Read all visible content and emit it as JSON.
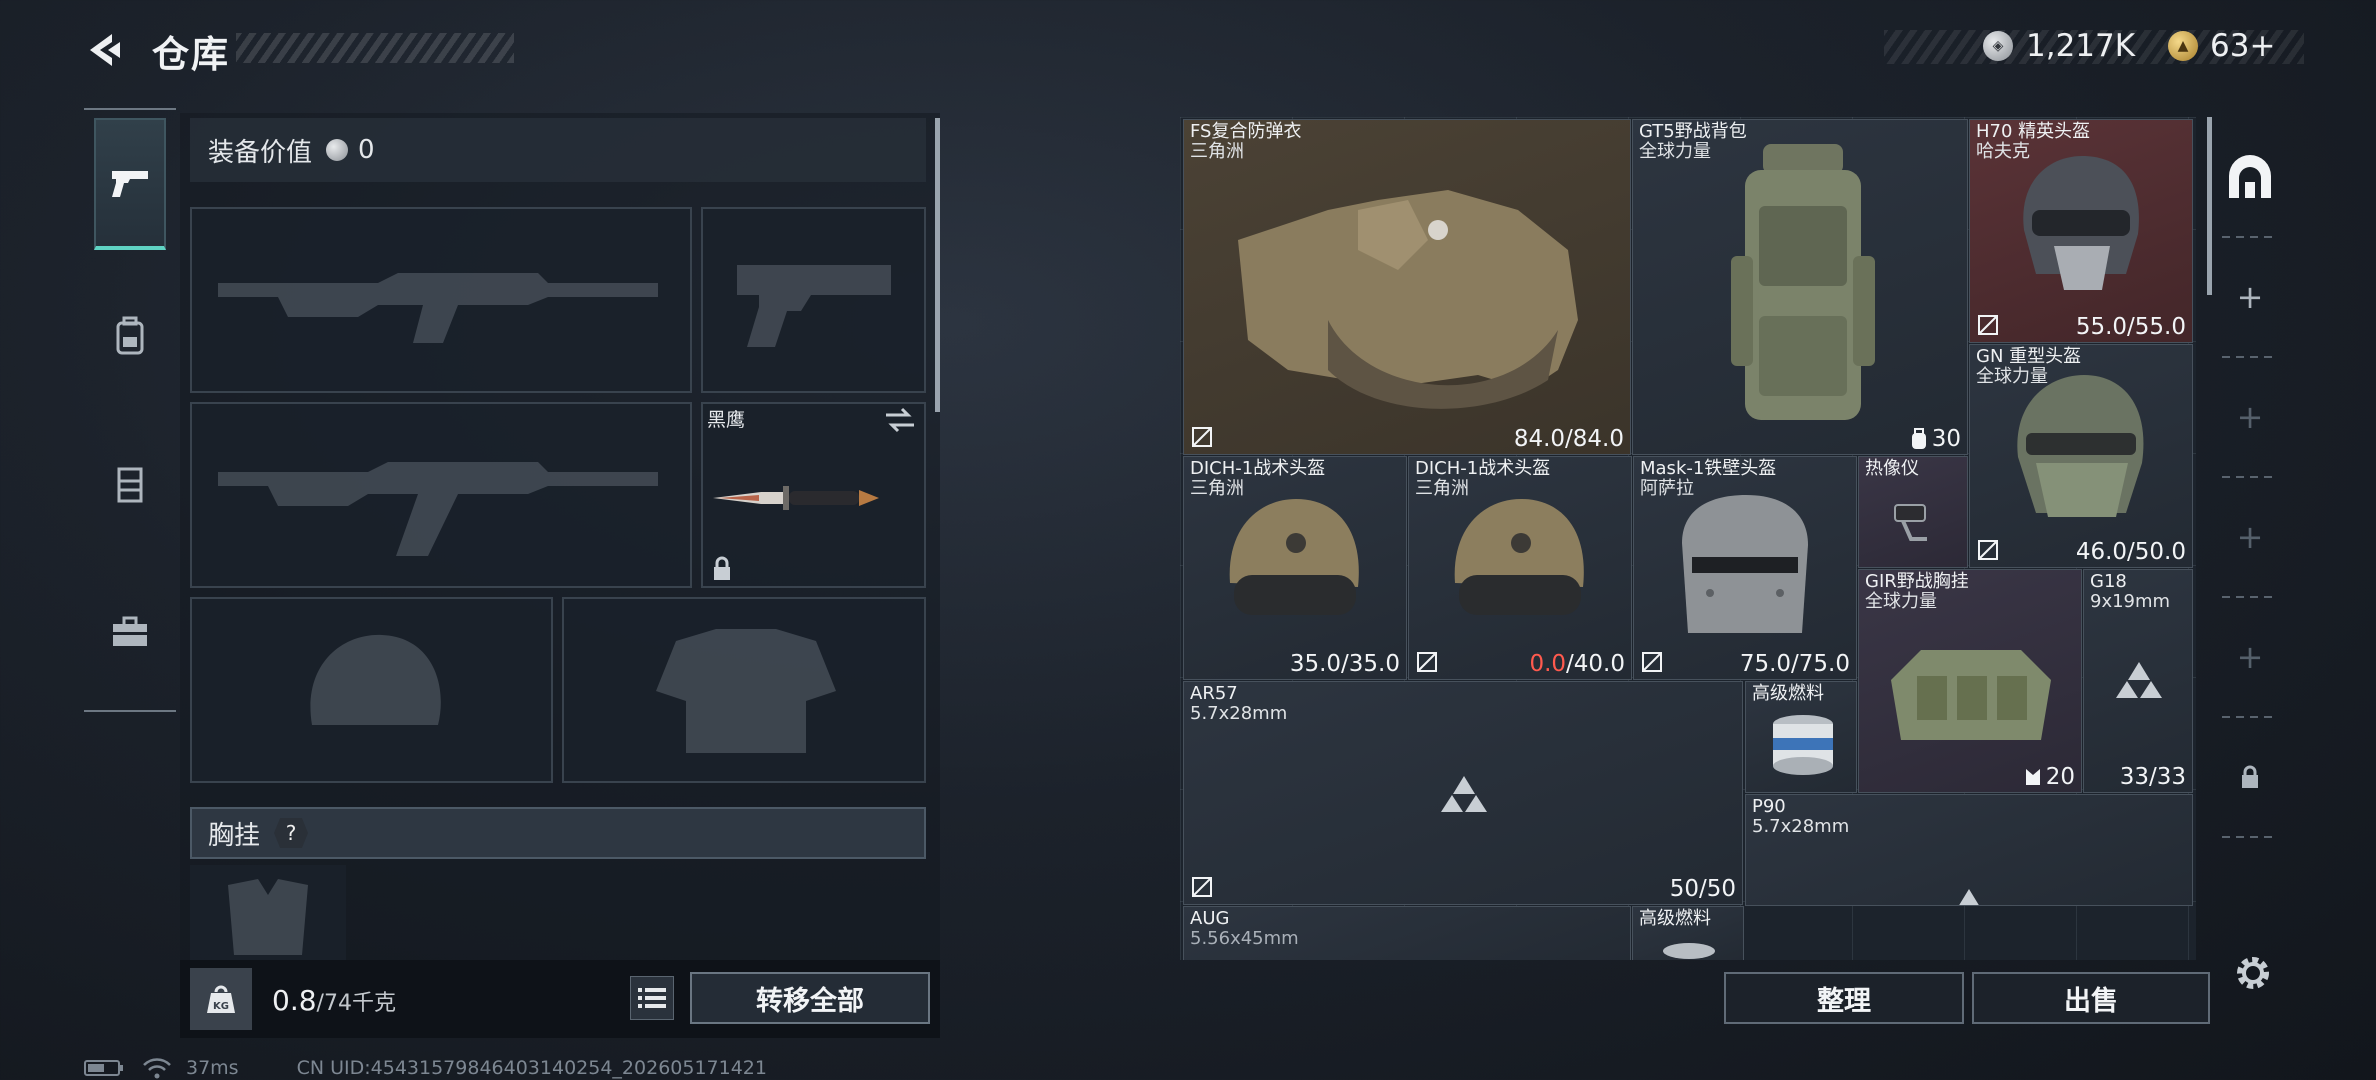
{
  "header": {
    "title": "仓库"
  },
  "currency": {
    "silver": "1,217K",
    "gold": "63+"
  },
  "loadout": {
    "value_label": "装备价值",
    "value": "0",
    "knife_name": "黑鹰",
    "rig_label": "胸挂",
    "rig_help": "?",
    "weight_current": "0.8",
    "weight_max": "/74千克",
    "transfer_all": "转移全部"
  },
  "stash": {
    "items": [
      {
        "name": "FS复合防弹衣",
        "sub": "三角洲",
        "durability": "84.0/84.0"
      },
      {
        "name": "GT5野战背包",
        "sub": "全球力量",
        "capacity": "30"
      },
      {
        "name": "H70 精英头盔",
        "sub": "哈夫克",
        "durability": "55.0/55.0"
      },
      {
        "name": "GN 重型头盔",
        "sub": "全球力量",
        "durability": "46.0/50.0"
      },
      {
        "name": "DICH-1战术头盔",
        "sub": "三角洲",
        "durability": "35.0/35.0"
      },
      {
        "name": "DICH-1战术头盔",
        "sub": "三角洲",
        "durability_current": "0.0",
        "durability_max": "/40.0"
      },
      {
        "name": "Mask-1铁壁头盔",
        "sub": "阿萨拉",
        "durability": "75.0/75.0"
      },
      {
        "name": "热像仪"
      },
      {
        "name": "GIR野战胸挂",
        "sub": "全球力量",
        "capacity": "20"
      },
      {
        "name": "G18",
        "sub": "9x19mm",
        "count": "33/33"
      },
      {
        "name": "AR57",
        "sub": "5.7x28mm",
        "count": "50/50"
      },
      {
        "name": "高级燃料"
      },
      {
        "name": "P90",
        "sub": "5.7x28mm"
      },
      {
        "name": "AUG",
        "sub": "5.56x45mm"
      },
      {
        "name": "高级燃料"
      }
    ],
    "sort_label": "整理",
    "sell_label": "出售"
  },
  "status": {
    "ping": "37ms",
    "uid": "CN UID:45431579846403140254_202605171421"
  },
  "colors": {
    "accent": "#5fd3c3",
    "durability_zero": "#ff5a4e",
    "item_tan": "#4b4235",
    "item_red": "#5a3337",
    "item_purple": "#3a3646"
  }
}
